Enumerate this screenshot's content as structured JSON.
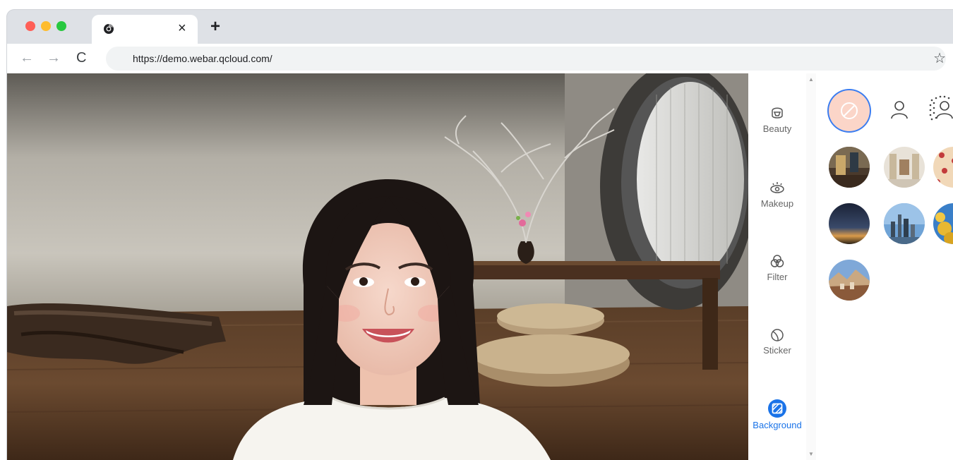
{
  "browser": {
    "url": "https://demo.webar.qcloud.com/",
    "tab_close": "×",
    "new_tab": "+",
    "back": "←",
    "forward": "→",
    "reload": "C",
    "bookmark": "☆"
  },
  "sidenav": {
    "items": [
      {
        "label": "Beauty",
        "icon": "beauty-icon",
        "active": false
      },
      {
        "label": "Makeup",
        "icon": "eye-icon",
        "active": false
      },
      {
        "label": "Filter",
        "icon": "filter-icon",
        "active": false
      },
      {
        "label": "Sticker",
        "icon": "sticker-icon",
        "active": false
      },
      {
        "label": "Background",
        "icon": "background-icon",
        "active": true
      }
    ]
  },
  "colors": {
    "accent": "#1a73e8",
    "selected_ring": "#3b7df0",
    "none_fill": "#fbd5c8",
    "traffic_red": "#ff5f57",
    "traffic_yellow": "#febc2e",
    "traffic_green": "#28c840"
  },
  "panel": {
    "top_row": [
      "none-icon",
      "person-icon",
      "blur-person-icon"
    ],
    "backgrounds": [
      "interior-room",
      "bright-lobby",
      "red-flower-pattern",
      "night-sky",
      "city-skyline",
      "yellow-flowers",
      "mountain-town"
    ]
  }
}
